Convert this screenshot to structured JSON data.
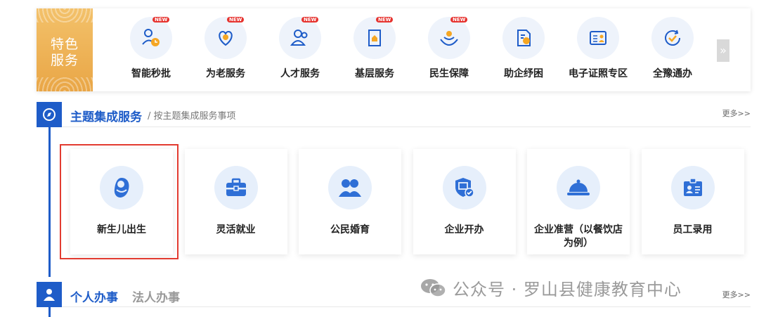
{
  "featured": {
    "badge_label": "特色\n服务",
    "items": [
      {
        "label": "智能秒批",
        "new": "NEW",
        "icon": "clock-person-icon"
      },
      {
        "label": "为老服务",
        "new": "NEW",
        "icon": "heart-hands-icon"
      },
      {
        "label": "人才服务",
        "new": "NEW",
        "icon": "people-icon"
      },
      {
        "label": "基层服务",
        "new": "NEW",
        "icon": "building-doc-icon"
      },
      {
        "label": "民生保障",
        "new": "NEW",
        "icon": "hands-person-icon"
      },
      {
        "label": "助企纾困",
        "icon": "doc-chart-icon"
      },
      {
        "label": "电子证照专区",
        "icon": "id-card-icon"
      },
      {
        "label": "全豫通办",
        "icon": "check-circle-icon"
      }
    ],
    "next_label": "»"
  },
  "theme_section": {
    "title": "主题集成服务",
    "subtitle": "/ 按主题集成服务事项",
    "more": "更多>>",
    "cards": [
      {
        "label": "新生儿出生",
        "icon": "baby-icon"
      },
      {
        "label": "灵活就业",
        "icon": "briefcase-icon"
      },
      {
        "label": "公民婚育",
        "icon": "couple-icon"
      },
      {
        "label": "企业开办",
        "icon": "shield-check-icon"
      },
      {
        "label": "企业准营（以餐饮店为例）",
        "icon": "cloche-icon"
      },
      {
        "label": "员工录用",
        "icon": "badge-icon"
      }
    ]
  },
  "bottom_section": {
    "tab_personal": "个人办事",
    "tab_legal": "法人办事",
    "more": "更多>>"
  },
  "watermark": "公众号 · 罗山县健康教育中心",
  "colors": {
    "primary": "#1e5cc8",
    "gold": "#eeb352",
    "highlight": "#e23b30"
  }
}
